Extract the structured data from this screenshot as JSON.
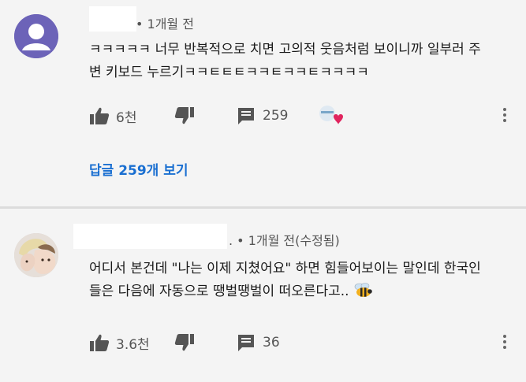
{
  "comments": [
    {
      "timestamp": "• 1개월 전",
      "lines": [
        "ㅋㅋㅋㅋㅋ 너무 반복적으로 치면 고의적 웃음처럼 보이니까 일부러 주",
        "변 키보드 누르기ㅋㅋㅌㅌㅌㅋㅋㅌㅋㅋㅌㅋㅋㅋㅋ"
      ],
      "likes": "6천",
      "replies": "259",
      "view_replies": "답글 259개 보기"
    },
    {
      "timestamp": ". • 1개월 전(수정됨)",
      "lines": [
        "어디서 본건데 \"나는 이제 지쳤어요\" 하면 힘들어보이는 말인데 한국인",
        "들은 다음에 자동으로 땡벌땡벌이 떠오른다고.."
      ],
      "likes": "3.6천",
      "replies": "36"
    }
  ],
  "colors": {
    "link": "#1a6fd1",
    "avatar1": "#6c63b8",
    "heart": "#e0245e"
  },
  "icons": [
    "like-icon",
    "dislike-icon",
    "reply-icon",
    "more-icon",
    "creator-heart-icon",
    "bee-emoji"
  ]
}
